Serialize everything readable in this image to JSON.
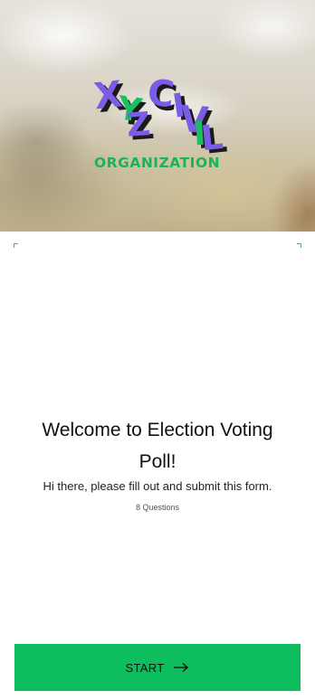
{
  "hero": {
    "logo": {
      "letters": [
        "X",
        "Y",
        "Z",
        "C",
        "I",
        "V",
        "I",
        "L"
      ],
      "subtitle": "ORGANIZATION",
      "colors": {
        "purple": "#7b5ce6",
        "green": "#18c060",
        "shadow": "#1b1b1b"
      }
    }
  },
  "welcome": {
    "title": "Welcome to Election Voting Poll!",
    "subtitle": "Hi there, please fill out and submit this form.",
    "question_count": "8 Questions"
  },
  "start_button": {
    "label": "START",
    "icon": "arrow-right-icon",
    "color": "#0ebe5e"
  }
}
